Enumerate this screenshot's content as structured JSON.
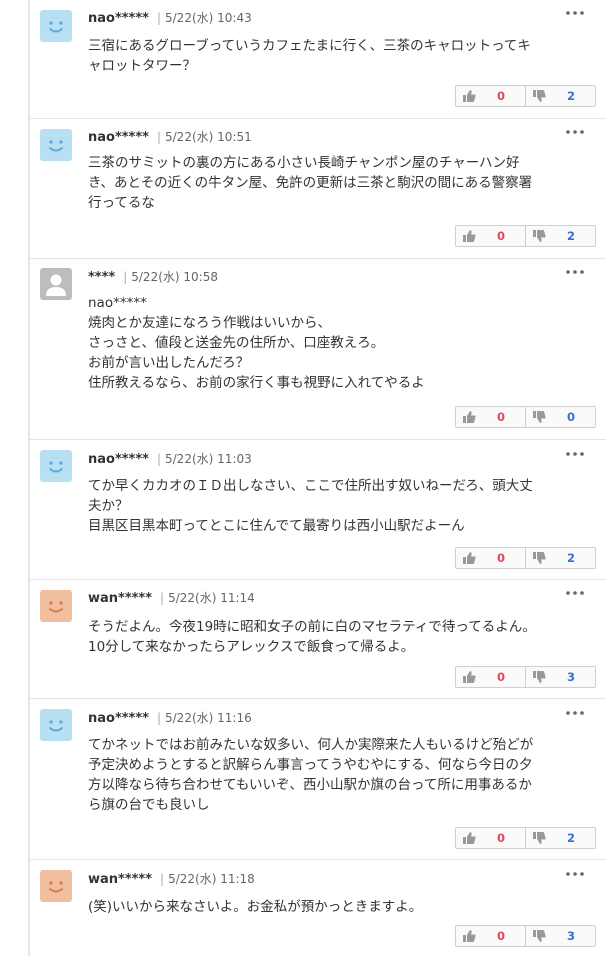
{
  "comments": [
    {
      "author": "nao*****",
      "date": "5/22(水) 10:43",
      "avatar": "smile-face-blue",
      "lines": [
        "三宿にあるグローブっていうカフェたまに行く、三茶のキャロットってキ",
        "ャロットタワー？"
      ],
      "good": "0",
      "bad": "2"
    },
    {
      "author": "nao*****",
      "date": "5/22(水) 10:51",
      "avatar": "smile-face-blue",
      "lines": [
        "三茶のサミットの裏の方にある小さい長崎チャンポン屋のチャーハン好",
        "き、あとその近くの牛タン屋、免許の更新は三茶と駒沢の間にある警察署",
        "行ってるな"
      ],
      "good": "0",
      "bad": "2"
    },
    {
      "author": "****",
      "date": "5/22(水) 10:58",
      "avatar": "default-user-gray",
      "lines": [
        "nao*****",
        "焼肉とか友達になろう作戦はいいから、",
        "さっさと、値段と送金先の住所か、口座教えろ。",
        "お前が言い出したんだろ？",
        "住所教えるなら、お前の家行く事も視野に入れてやるよ"
      ],
      "good": "0",
      "bad": "0"
    },
    {
      "author": "nao*****",
      "date": "5/22(水) 11:03",
      "avatar": "smile-face-blue",
      "lines": [
        "てか早くカカオのＩＤ出しなさい、ここで住所出す奴いねーだろ、頭大丈",
        "夫か？",
        "目黒区目黒本町ってとこに住んでて最寄りは西小山駅だよーん"
      ],
      "good": "0",
      "bad": "2"
    },
    {
      "author": "wan*****",
      "date": "5/22(水) 11:14",
      "avatar": "smile-face-orange",
      "lines": [
        "そうだよん。今夜19時に昭和女子の前に白のマセラティで待ってるよん。",
        "10分して来なかったらアレックスで飯食って帰るよ。"
      ],
      "good": "0",
      "bad": "3"
    },
    {
      "author": "nao*****",
      "date": "5/22(水) 11:16",
      "avatar": "smile-face-blue",
      "lines": [
        "てかネットではお前みたいな奴多い、何人か実際来た人もいるけど殆どが",
        "予定決めようとすると訳解らん事言ってうやむやにする、何なら今日の夕",
        "方以降なら待ち合わせてもいいぞ、西小山駅か旗の台って所に用事あるか",
        "ら旗の台でも良いし"
      ],
      "good": "0",
      "bad": "2"
    },
    {
      "author": "wan*****",
      "date": "5/22(水) 11:18",
      "avatar": "smile-face-orange",
      "lines": [
        "(笑)いいから来なさいよ。お金私が預かっときますよ。"
      ],
      "good": "0",
      "bad": "3"
    }
  ],
  "colors": {
    "avatar_blue": "#b9dff3",
    "avatar_orange": "#f1bf9f",
    "avatar_gray": "#bdbdbd",
    "good_count": "#e0475b",
    "bad_count": "#3a6ed0"
  },
  "icons": {
    "menu": "more-dots-icon",
    "good": "thumbs-up-icon",
    "bad": "thumbs-down-icon"
  }
}
